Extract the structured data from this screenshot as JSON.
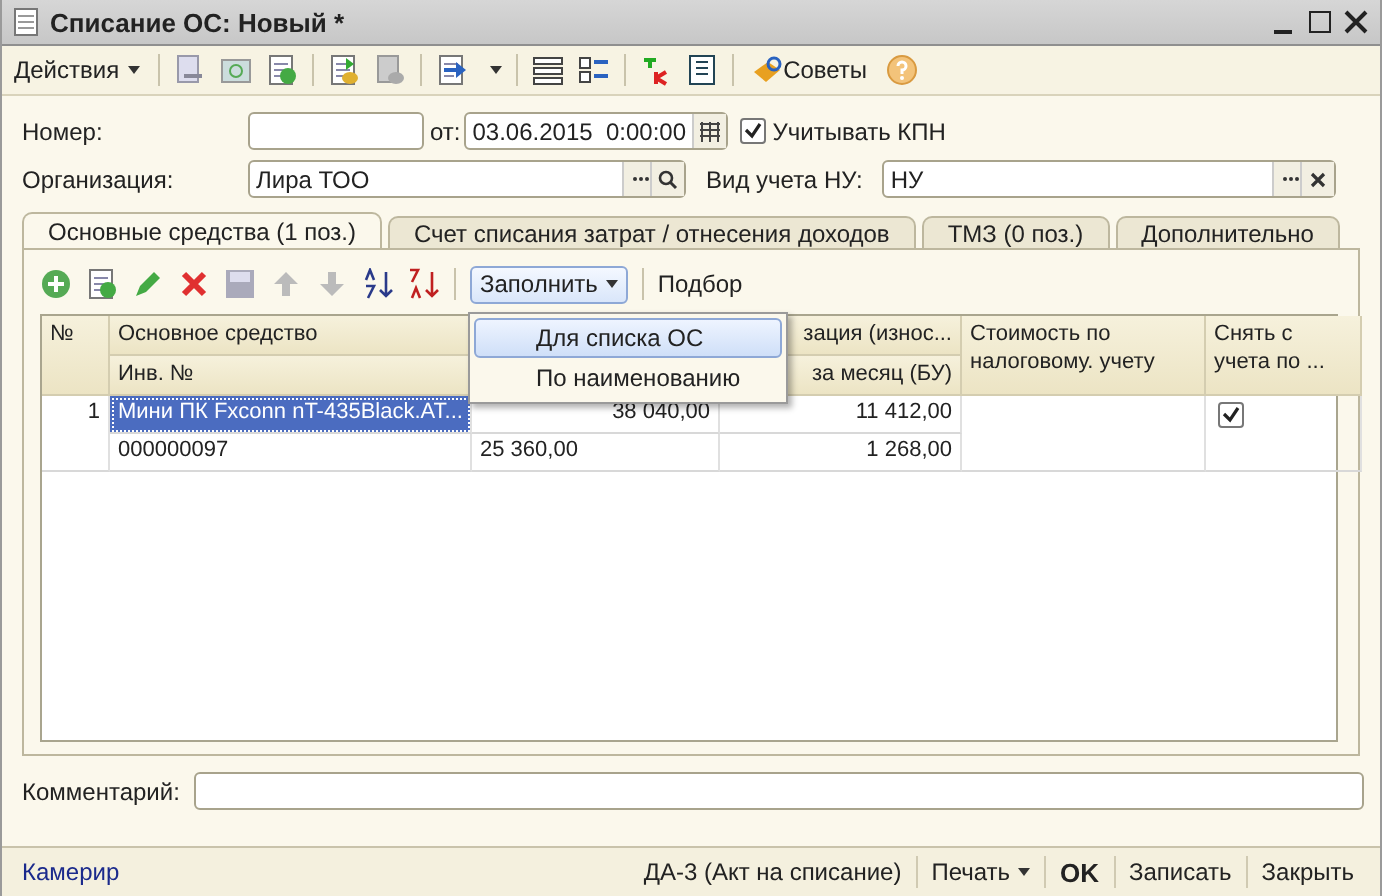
{
  "window": {
    "title": "Списание ОС: Новый *"
  },
  "toolbar": {
    "actions_menu": "Действия",
    "tips": "Советы"
  },
  "form": {
    "number": {
      "label": "Номер:"
    },
    "date": {
      "label": "от:",
      "value": "03.06.2015  0:00:00"
    },
    "kpn": {
      "label": "Учитывать КПН",
      "checked": true
    },
    "organization": {
      "label": "Организация:",
      "value": "Лира ТОО"
    },
    "tax_accounting": {
      "label": "Вид учета НУ:",
      "value": "НУ"
    }
  },
  "tabs": [
    {
      "label": "Основные средства (1 поз.)",
      "selected": true
    },
    {
      "label": "Счет списания затрат / отнесения доходов",
      "selected": false
    },
    {
      "label": "ТМЗ (0 поз.)",
      "selected": false
    },
    {
      "label": "Дополнительно",
      "selected": false
    }
  ],
  "table_toolbar": {
    "fill_button": "Заполнить",
    "pick_button": "Подбор"
  },
  "fill_menu": [
    {
      "label": "Для списка ОС",
      "selected": true
    },
    {
      "label": "По наименованию",
      "selected": false
    }
  ],
  "table": {
    "columns": {
      "number": "№",
      "asset": "Основное средство",
      "inventory_number": "Инв. №",
      "column_4_top": "зация (износ...",
      "column_4_bottom": "за месяц  (БУ)",
      "tax_cost": "Стоимость по налоговому. учету",
      "deregister": "Снять с учета по ..."
    },
    "rows": [
      {
        "number": "1",
        "asset": "Мини ПК Fxconn nT-435Black.AT...",
        "inventory_number": "000000097",
        "column_3_top": "38 040,00",
        "column_3_bottom": "25 360,00",
        "column_4_top": "11 412,00",
        "column_4_bottom": "1 268,00",
        "deregister": true,
        "selected": true
      }
    ]
  },
  "comment": {
    "label": "Комментарий:"
  },
  "status_bar": {
    "link": "Камерир",
    "buttons": [
      {
        "label": "ДА-3 (Акт на списание)",
        "kind": "plain"
      },
      {
        "label": "Печать",
        "kind": "menu"
      },
      {
        "label": "OK",
        "kind": "default"
      },
      {
        "label": "Записать",
        "kind": "plain"
      },
      {
        "label": "Закрыть",
        "kind": "plain"
      }
    ]
  }
}
